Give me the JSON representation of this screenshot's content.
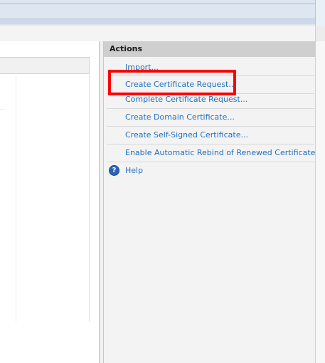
{
  "actions": {
    "header": "Actions",
    "items": [
      {
        "label": "Import...",
        "icon": null
      },
      {
        "label": "Create Certificate Request...",
        "icon": null
      },
      {
        "label": "Complete Certificate Request...",
        "icon": null
      },
      {
        "label": "Create Domain Certificate...",
        "icon": null
      },
      {
        "label": "Create Self-Signed Certificate...",
        "icon": null
      },
      {
        "label": "Enable Automatic Rebind of Renewed Certificate",
        "icon": null
      },
      {
        "label": "Help",
        "icon": "help-icon"
      }
    ]
  },
  "colors": {
    "link": "#1f6fc0",
    "highlight_box": "#ff0000",
    "actions_header_bg": "#cfcfcf"
  }
}
